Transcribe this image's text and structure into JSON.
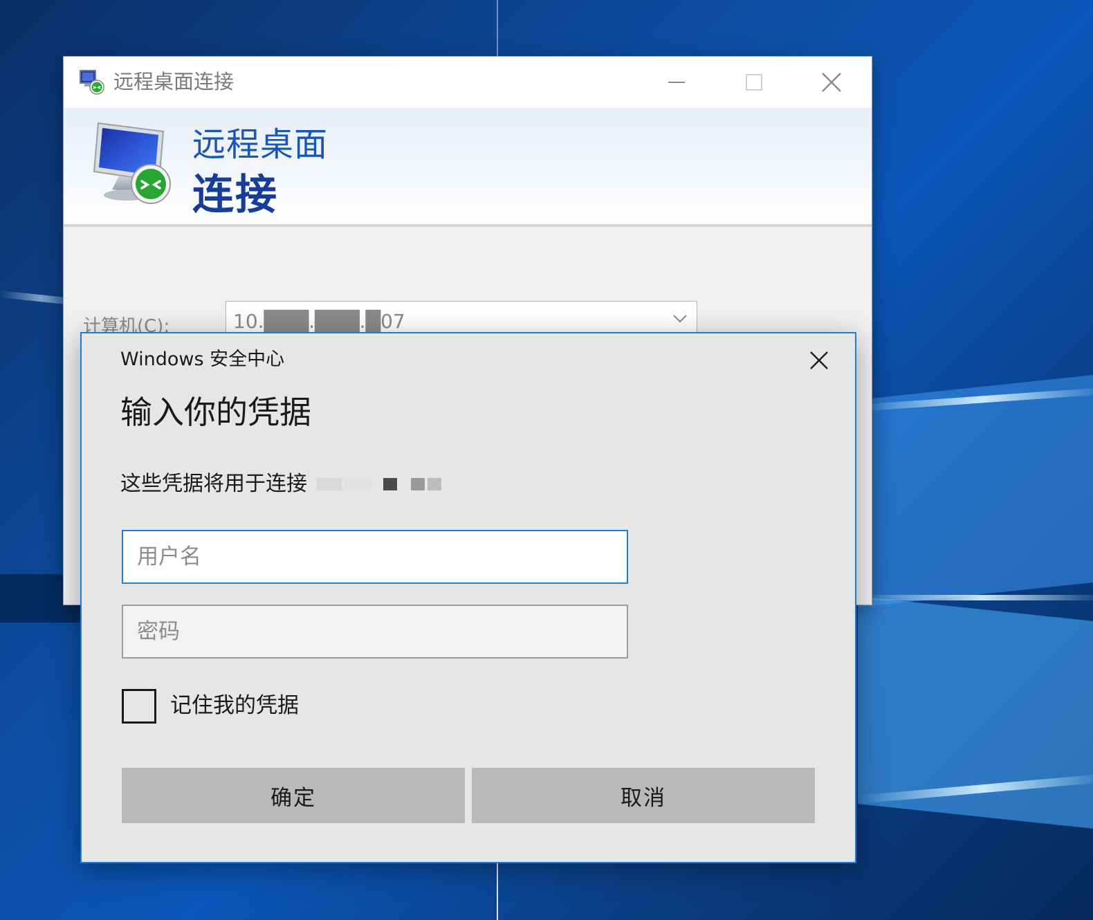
{
  "rdp_window": {
    "title": "远程桌面连接",
    "banner_line1": "远程桌面",
    "banner_line2": "连接",
    "computer_label": "计算机(C):",
    "computer_value": "10.███.███.█07"
  },
  "security_dialog": {
    "app_name": "Windows 安全中心",
    "heading": "输入你的凭据",
    "description": "这些凭据将用于连接",
    "username_placeholder": "用户名",
    "password_placeholder": "密码",
    "remember_label": "记住我的凭据",
    "remember_checked": false,
    "ok_label": "确定",
    "cancel_label": "取消"
  },
  "colors": {
    "accent": "#1c7fd6",
    "banner_title": "#1a56b6",
    "banner_title_bold": "#173c99",
    "dialog_bg": "#e6e6e6",
    "button_bg": "#b9b9b9"
  },
  "icons": {
    "app": "remote-desktop-icon",
    "banner": "monitor-connect-icon",
    "minimize": "minimize-icon",
    "maximize": "maximize-icon",
    "close": "close-icon",
    "dropdown": "chevron-down-icon"
  }
}
